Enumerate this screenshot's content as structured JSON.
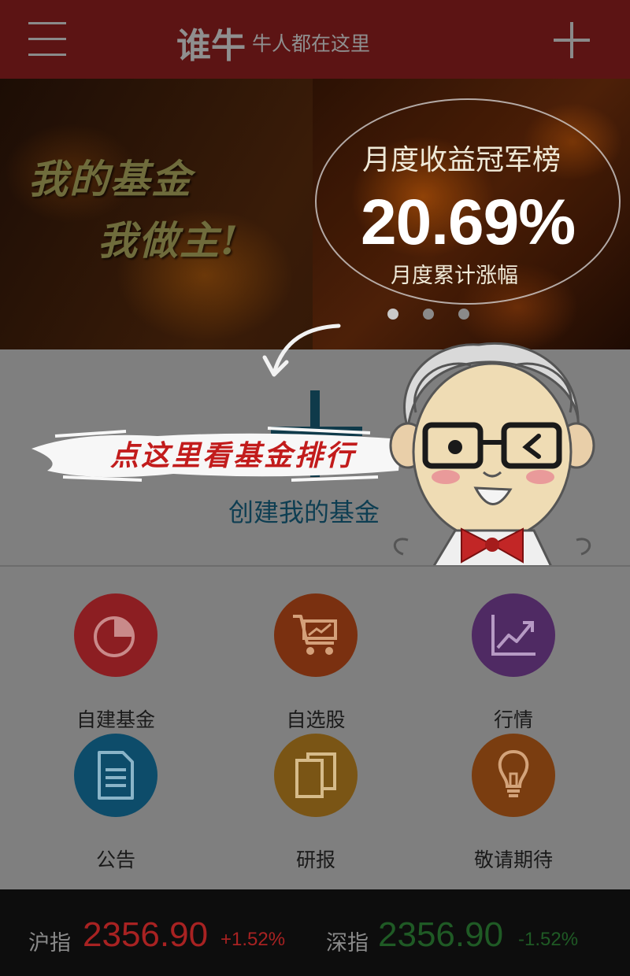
{
  "header": {
    "brand_name": "谁牛",
    "brand_slogan": "牛人都在这里",
    "menu_icon": "menu-icon",
    "add_icon": "plus-icon"
  },
  "banner": {
    "slogan_line1": "我的基金",
    "slogan_line2": "我做主!",
    "rank_title": "月度收益冠军榜",
    "rank_value": "20.69%",
    "rank_subtitle": "月度累计涨幅",
    "active_slide": 1,
    "slide_count": 3
  },
  "create": {
    "hint": "点这里看基金排行",
    "label": "创建我的基金"
  },
  "grid": {
    "items": [
      {
        "label": "自建基金",
        "icon": "pie-chart-icon",
        "color": "#8c1e22"
      },
      {
        "label": "自选股",
        "icon": "cart-chart-icon",
        "color": "#7a3010"
      },
      {
        "label": "行情",
        "icon": "line-chart-icon",
        "color": "#4f2a63"
      },
      {
        "label": "公告",
        "icon": "document-icon",
        "color": "#0d4c6a"
      },
      {
        "label": "研报",
        "icon": "copy-icon",
        "color": "#7a5515"
      },
      {
        "label": "敬请期待",
        "icon": "lightbulb-icon",
        "color": "#7a3d10"
      }
    ]
  },
  "ticker": {
    "sh": {
      "name": "沪指",
      "value": "2356.90",
      "change": "+1.52%",
      "color": "#a82222"
    },
    "sz": {
      "name": "深指",
      "value": "2356.90",
      "change": "-1.52%",
      "color": "#1f5a25"
    }
  }
}
